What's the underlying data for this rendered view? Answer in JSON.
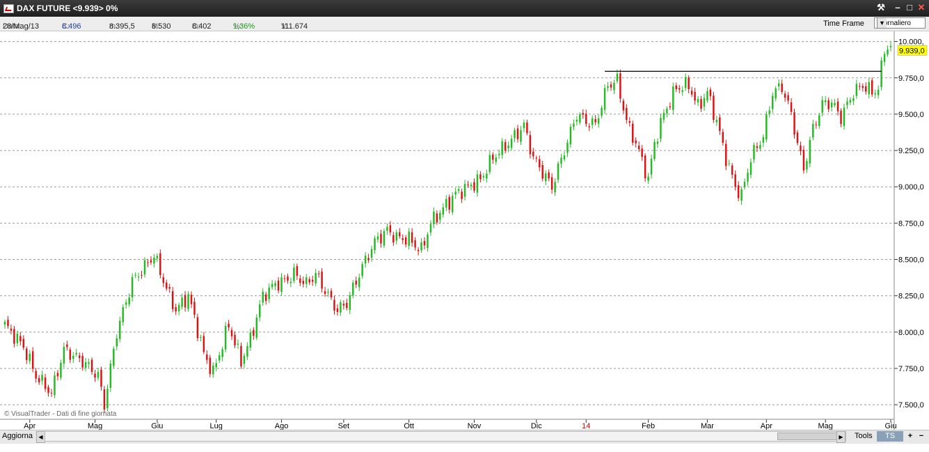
{
  "window": {
    "title": "DAX FUTURE <9.939> 0%"
  },
  "info": {
    "data_label": "Data:",
    "data_value": "28/Mag/13",
    "c_label": "C:",
    "c_value": "8.496",
    "m_label": "m:",
    "m_value": "8.395,5",
    "max_label": "M:",
    "max_value": "8.530",
    "o_label": "O:",
    "o_value": "8.402",
    "pct_label": "%:",
    "pct_value": "1,36%",
    "v_label": "V:",
    "v_value": "111.674",
    "time_frame_label": "Time Frame",
    "time_frame_value": "Giornaliero"
  },
  "bottom": {
    "aggiorna": "Aggiorna",
    "tools": "Tools",
    "ts_off": "TS OFF",
    "zoom_in": "+",
    "zoom_out": "−"
  },
  "colors": {
    "up": "#22bb22",
    "down": "#dd1111",
    "price_tag": "#ffff00",
    "grid": "#9a9a9a",
    "year_label": "#e00000"
  },
  "chart_data": {
    "type": "candlestick",
    "watermark": "© VisualTrader - Dati di fine giornata",
    "y_axis": {
      "min": 7400,
      "max": 10070,
      "ticks": [
        10000,
        9750,
        9500,
        9250,
        9000,
        8750,
        8500,
        8250,
        8000,
        7750,
        7500
      ],
      "tick_labels": [
        "10.000,",
        "9.750,0",
        "9.500,0",
        "9.250,0",
        "9.000,0",
        "8.750,0",
        "8.500,0",
        "8.250,0",
        "8.000,0",
        "7.750,0",
        "7.500,0"
      ]
    },
    "x_axis": {
      "labels": [
        {
          "label": "Apr",
          "index": 8,
          "highlight": false
        },
        {
          "label": "Mag",
          "index": 29,
          "highlight": false
        },
        {
          "label": "Giu",
          "index": 49,
          "highlight": false
        },
        {
          "label": "Lug",
          "index": 68,
          "highlight": false
        },
        {
          "label": "Ago",
          "index": 89,
          "highlight": false
        },
        {
          "label": "Set",
          "index": 109,
          "highlight": false
        },
        {
          "label": "Ott",
          "index": 130,
          "highlight": false
        },
        {
          "label": "Nov",
          "index": 151,
          "highlight": false
        },
        {
          "label": "Dic",
          "index": 171,
          "highlight": false
        },
        {
          "label": "14",
          "index": 187,
          "highlight": true
        },
        {
          "label": "Feb",
          "index": 207,
          "highlight": false
        },
        {
          "label": "Mar",
          "index": 226,
          "highlight": false
        },
        {
          "label": "Apr",
          "index": 245,
          "highlight": false
        },
        {
          "label": "Mag",
          "index": 264,
          "highlight": false
        },
        {
          "label": "Giu",
          "index": 285,
          "highlight": false
        }
      ]
    },
    "last_price_label": "9.939,0",
    "last_price": 9939,
    "resistance": {
      "start_index": 193,
      "end_index": 282,
      "value": 9795
    },
    "anchors": [
      [
        0,
        8050
      ],
      [
        6,
        7900
      ],
      [
        10,
        7700
      ],
      [
        15,
        7580
      ],
      [
        19,
        7880
      ],
      [
        25,
        7800
      ],
      [
        30,
        7700
      ],
      [
        32,
        7500
      ],
      [
        36,
        8000
      ],
      [
        41,
        8350
      ],
      [
        45,
        8450
      ],
      [
        48,
        8530
      ],
      [
        52,
        8300
      ],
      [
        55,
        8150
      ],
      [
        59,
        8250
      ],
      [
        61,
        8100
      ],
      [
        64,
        7850
      ],
      [
        67,
        7720
      ],
      [
        72,
        8050
      ],
      [
        76,
        7800
      ],
      [
        79,
        7950
      ],
      [
        83,
        8250
      ],
      [
        87,
        8330
      ],
      [
        90,
        8350
      ],
      [
        93,
        8400
      ],
      [
        97,
        8330
      ],
      [
        100,
        8400
      ],
      [
        104,
        8250
      ],
      [
        107,
        8150
      ],
      [
        110,
        8200
      ],
      [
        115,
        8450
      ],
      [
        119,
        8620
      ],
      [
        123,
        8700
      ],
      [
        126,
        8650
      ],
      [
        130,
        8640
      ],
      [
        134,
        8560
      ],
      [
        137,
        8750
      ],
      [
        141,
        8850
      ],
      [
        145,
        8950
      ],
      [
        149,
        9000
      ],
      [
        153,
        9050
      ],
      [
        157,
        9200
      ],
      [
        162,
        9300
      ],
      [
        167,
        9420
      ],
      [
        170,
        9200
      ],
      [
        173,
        9100
      ],
      [
        176,
        9000
      ],
      [
        180,
        9250
      ],
      [
        184,
        9500
      ],
      [
        187,
        9450
      ],
      [
        190,
        9430
      ],
      [
        194,
        9700
      ],
      [
        197,
        9730
      ],
      [
        200,
        9450
      ],
      [
        203,
        9300
      ],
      [
        205,
        9180
      ],
      [
        207,
        9050
      ],
      [
        209,
        9300
      ],
      [
        212,
        9500
      ],
      [
        216,
        9680
      ],
      [
        220,
        9700
      ],
      [
        223,
        9550
      ],
      [
        226,
        9650
      ],
      [
        229,
        9450
      ],
      [
        232,
        9200
      ],
      [
        235,
        9000
      ],
      [
        237,
        8940
      ],
      [
        240,
        9200
      ],
      [
        244,
        9350
      ],
      [
        247,
        9650
      ],
      [
        250,
        9690
      ],
      [
        253,
        9500
      ],
      [
        255,
        9300
      ],
      [
        257,
        9120
      ],
      [
        260,
        9400
      ],
      [
        263,
        9570
      ],
      [
        266,
        9580
      ],
      [
        269,
        9480
      ],
      [
        273,
        9650
      ],
      [
        276,
        9700
      ],
      [
        279,
        9650
      ],
      [
        281,
        9680
      ],
      [
        283,
        9950
      ],
      [
        285,
        9965
      ]
    ]
  }
}
